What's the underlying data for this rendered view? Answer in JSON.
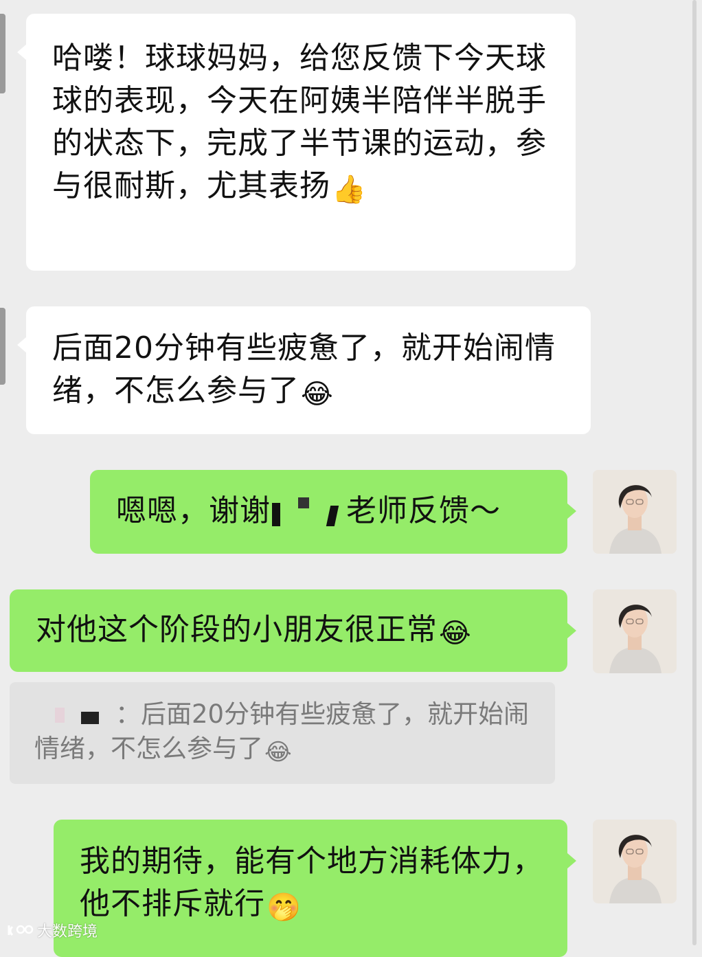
{
  "messages": [
    {
      "side": "incoming",
      "text": "哈喽！球球妈妈，给您反馈下今天球球的表现，今天在阿姨半陪伴半脱手的状态下，完成了半节课的运动，参与很耐斯，尤其表扬",
      "emoji_icon": "thumbs-up-icon",
      "emoji_glyph": "👍"
    },
    {
      "side": "incoming",
      "text": "后面20分钟有些疲惫了，就开始闹情绪，不怎么参与了",
      "emoji_icon": "tears-of-joy-icon",
      "emoji_glyph": "😂"
    },
    {
      "side": "outgoing",
      "text_before": "嗯嗯，谢谢",
      "text_after": "老师反馈～"
    },
    {
      "side": "outgoing",
      "text": "对他这个阶段的小朋友很正常",
      "emoji_icon": "tears-of-joy-icon",
      "emoji_glyph": "😂"
    },
    {
      "side": "outgoing",
      "text": "我的期待，能有个地方消耗体力，他不排斥就行",
      "emoji_icon": "hand-over-mouth-icon",
      "emoji_glyph": "🤭"
    }
  ],
  "quote": {
    "separator": "：",
    "text": "后面20分钟有些疲惫了，就开始闹情绪，不怎么参与了",
    "emoji_icon": "tears-of-joy-icon",
    "emoji_glyph": "😂"
  },
  "watermark": {
    "text": "大数跨境",
    "icon": "watermark-logo-icon"
  },
  "colors": {
    "background": "#ededed",
    "incoming_bubble": "#ffffff",
    "outgoing_bubble": "#95ec69"
  }
}
